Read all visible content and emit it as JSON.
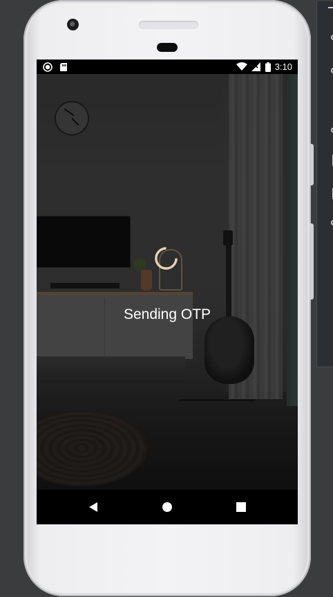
{
  "status_bar": {
    "time": "3:10",
    "left_icons": [
      "record-icon",
      "sd-card-icon"
    ],
    "right_icons": [
      "wifi-icon",
      "signal-icon",
      "battery-icon"
    ]
  },
  "loading": {
    "message": "Sending OTP",
    "spinner_color": "#e8d2b4"
  },
  "nav_bar": {
    "buttons": [
      "back-icon",
      "home-icon",
      "recents-icon"
    ]
  },
  "colors": {
    "background": "#3b3c3e",
    "phone_body": "#f0f0f2",
    "screen_bar": "#000000",
    "text": "#ffffff"
  }
}
